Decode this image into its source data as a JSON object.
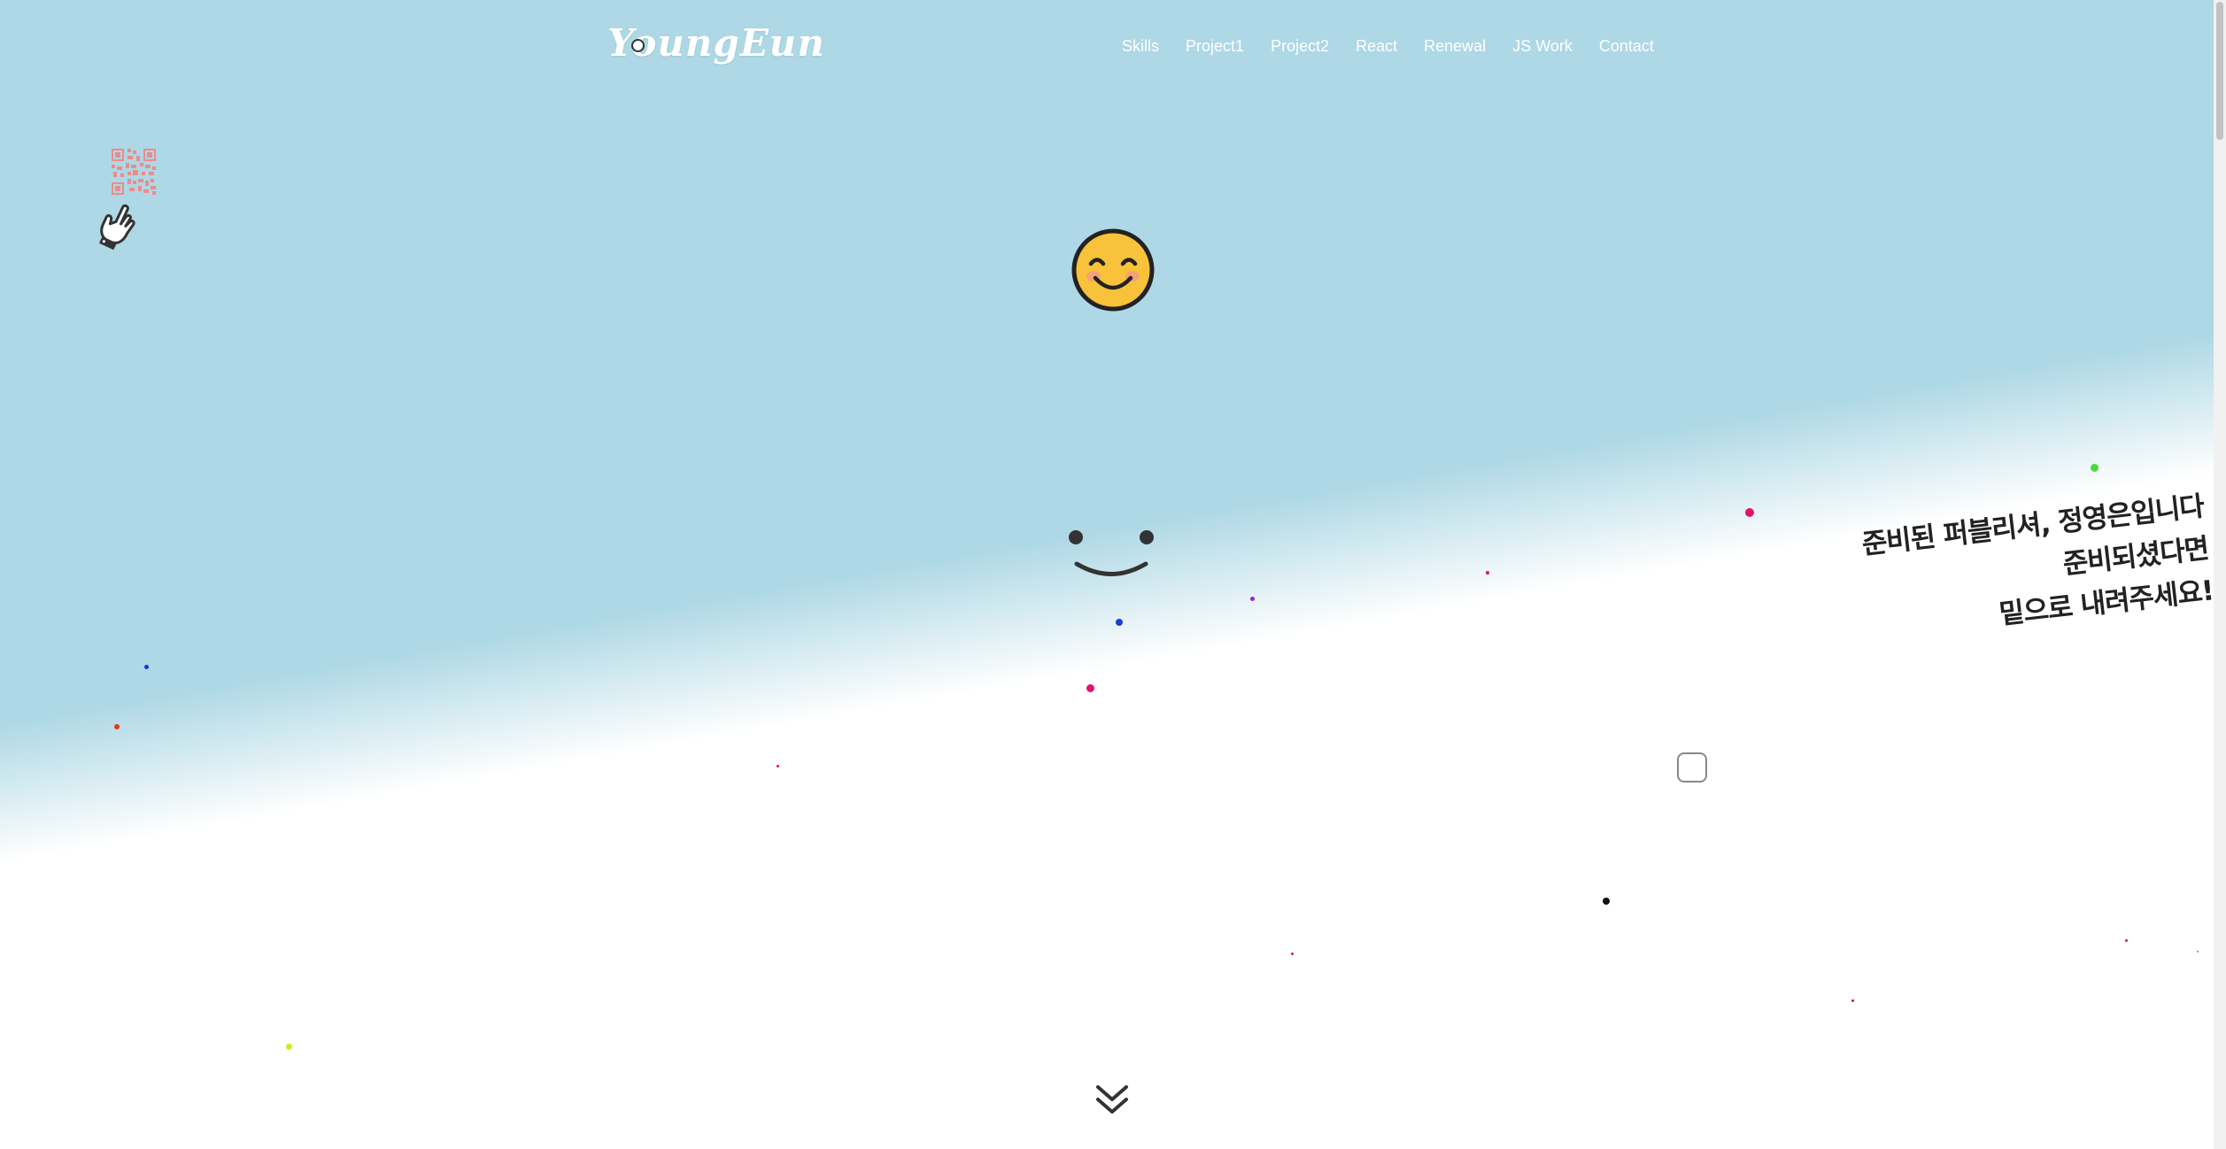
{
  "header": {
    "logo": "YoungEun",
    "nav": [
      {
        "label": "Skills"
      },
      {
        "label": "Project1"
      },
      {
        "label": "Project2"
      },
      {
        "label": "React"
      },
      {
        "label": "Renewal"
      },
      {
        "label": "JS Work"
      },
      {
        "label": "Contact"
      }
    ]
  },
  "hero": {
    "intro_lines": [
      "준비된 퍼블리셔, 정영은입니다",
      "준비되셨다면",
      "밑으로 내려주세요!"
    ]
  },
  "icons": {
    "qr": "qr-code-icon",
    "hand": "pointing-hand-icon",
    "emoji": "smiling-face-icon",
    "face": "simple-face-icon",
    "scroll": "double-chevron-down-icon"
  },
  "colors": {
    "sky": "#aed8e5",
    "background": "#ffffff",
    "text": "#222222",
    "qr": "#f08a8a",
    "emoji": "#f8c23a"
  }
}
